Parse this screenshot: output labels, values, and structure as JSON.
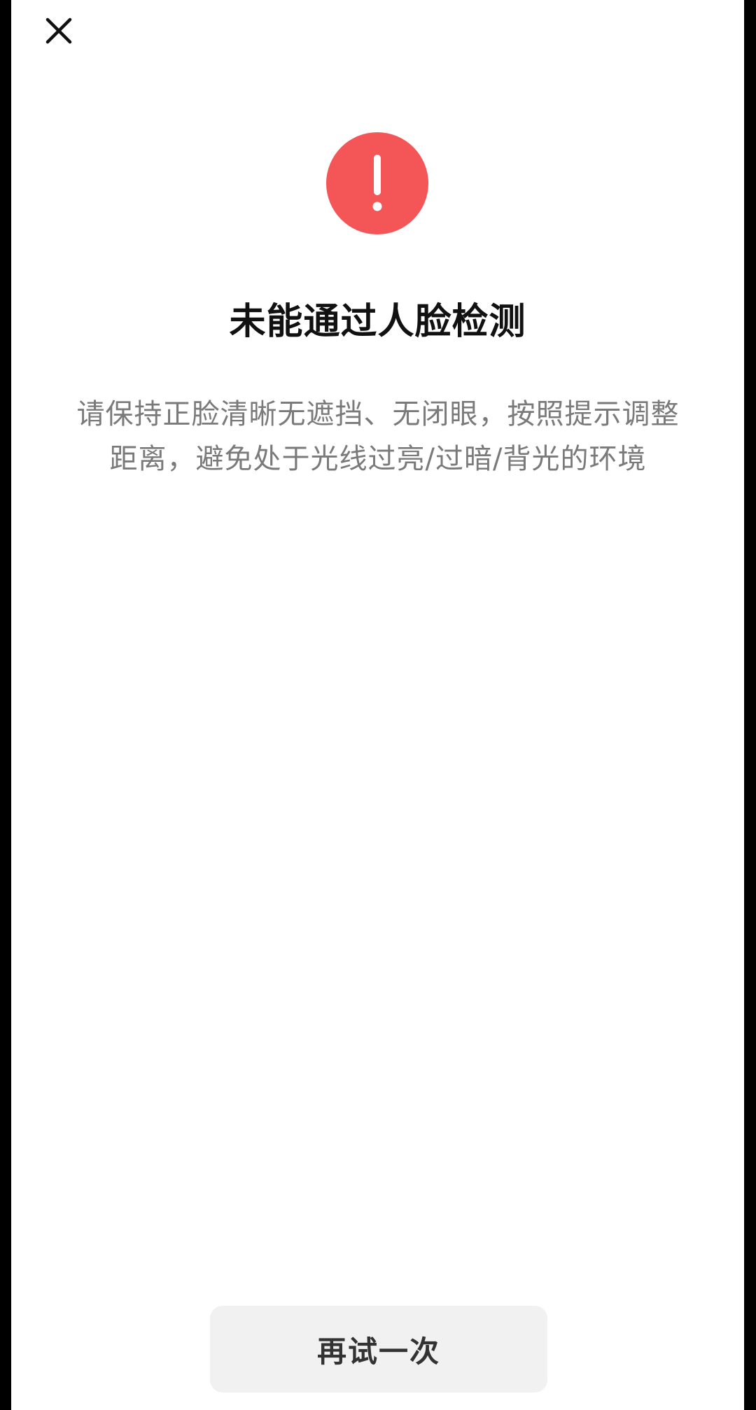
{
  "header": {
    "close_icon": "close-icon"
  },
  "status": {
    "icon": "exclamation-circle-icon",
    "icon_color": "#f45556",
    "title": "未能通过人脸检测",
    "description": "请保持正脸清晰无遮挡、无闭眼，按照提示调整距离，避免处于光线过亮/过暗/背光的环境"
  },
  "actions": {
    "retry_label": "再试一次"
  }
}
